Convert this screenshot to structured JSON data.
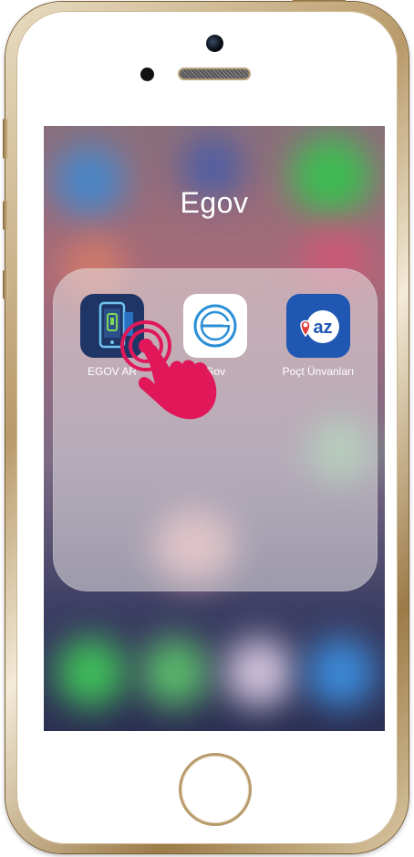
{
  "folder": {
    "title": "Egov",
    "apps": [
      {
        "label": "EGOV AR",
        "icon": "phone-ar-icon"
      },
      {
        "label": "Gov",
        "icon": "egov-logo-icon"
      },
      {
        "label": "Poçt Ünvanları",
        "icon": "map-pin-az-icon"
      }
    ]
  },
  "colors": {
    "hand_accent": "#e0185a",
    "ar_icon_bg": "#1f3566",
    "poct_icon_bg": "#1f57b3",
    "egov_icon_bg": "#ffffff",
    "phone_frame": "#b89a6a"
  }
}
